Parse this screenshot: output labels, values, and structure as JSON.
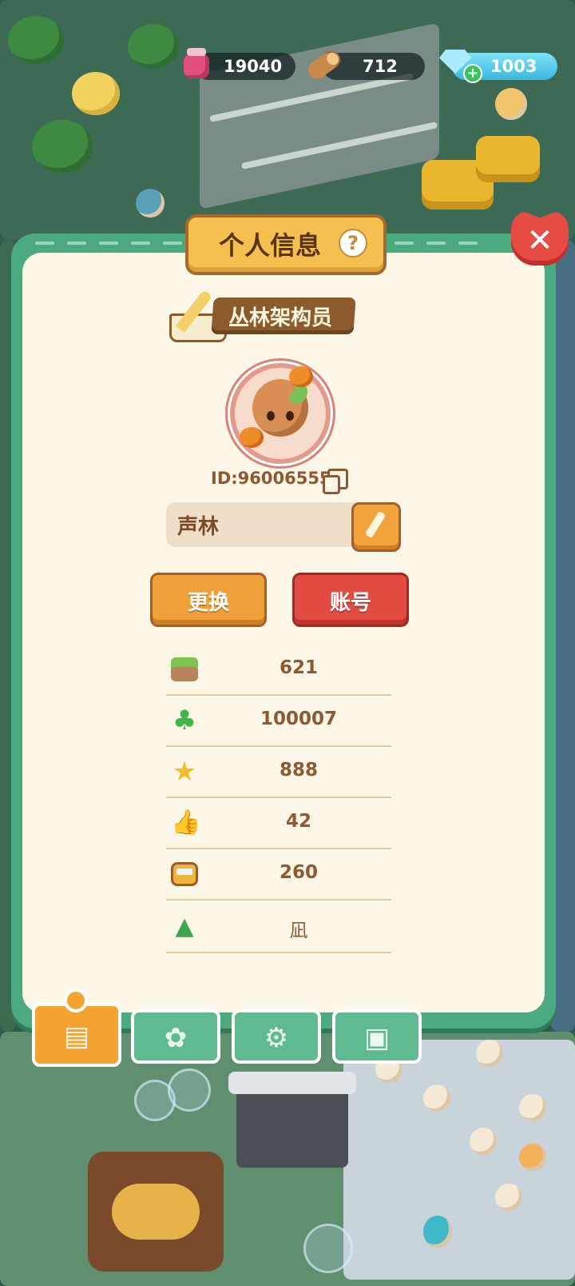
{
  "currencies": {
    "jam": {
      "value": "19040",
      "icon": "jam-jar-icon"
    },
    "wood": {
      "value": "712",
      "icon": "wood-log-icon"
    },
    "gems": {
      "value": "1003",
      "icon": "gem-icon",
      "add_icon": "plus-icon"
    }
  },
  "panel": {
    "title": "个人信息",
    "help_glyph": "?",
    "close_glyph": "✕",
    "badge_title": "丛林架构员",
    "user_id": "ID:96006555",
    "nickname": "声林",
    "buttons": {
      "change": "更换",
      "account": "账号"
    }
  },
  "stats": [
    {
      "icon": "grass-block-icon",
      "value": "621"
    },
    {
      "icon": "clover-icon",
      "value": "100007"
    },
    {
      "icon": "star-icon",
      "value": "888"
    },
    {
      "icon": "thumbs-up-icon",
      "value": "42"
    },
    {
      "icon": "bus-icon",
      "value": "260"
    },
    {
      "icon": "trees-icon",
      "value": "凪"
    }
  ],
  "tabs": [
    {
      "name": "profile",
      "icon": "profile-card-icon",
      "active": true
    },
    {
      "name": "badges",
      "icon": "badge-icon",
      "active": false
    },
    {
      "name": "settings",
      "icon": "gear-icon",
      "active": false
    },
    {
      "name": "gallery",
      "icon": "photo-album-icon",
      "active": false
    }
  ],
  "colors": {
    "panel_green": "#4caa80",
    "panel_cream": "#fbf6e5",
    "text_brown": "#8b5a35",
    "button_orange": "#efa038",
    "button_red": "#e24a42"
  }
}
